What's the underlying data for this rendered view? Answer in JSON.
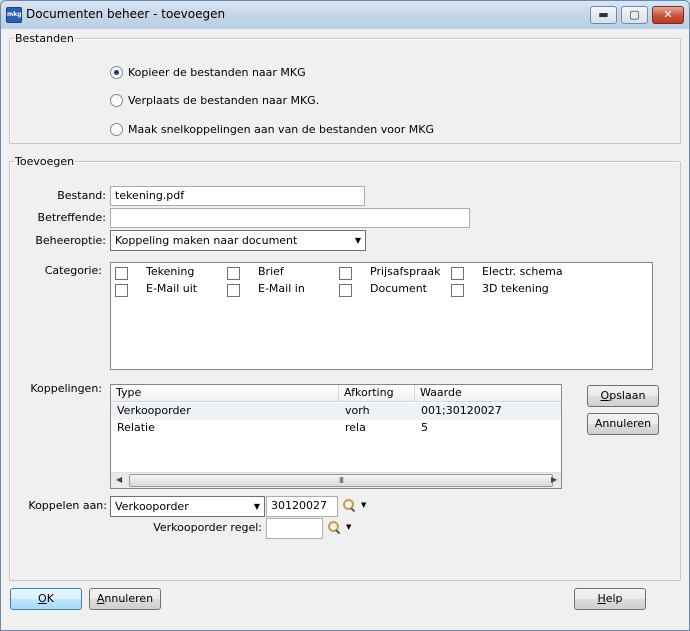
{
  "window": {
    "title": "Documenten beheer - toevoegen",
    "app_icon_text": "mkg",
    "minimize_glyph": "▬",
    "maximize_glyph": "▢",
    "close_glyph": "✕"
  },
  "bestanden": {
    "legend": "Bestanden",
    "options": [
      {
        "label": "Kopieer de bestanden naar MKG",
        "checked": true
      },
      {
        "label": "Verplaats de bestanden naar MKG.",
        "checked": false
      },
      {
        "label": "Maak snelkoppelingen aan van de bestanden voor MKG",
        "checked": false
      }
    ]
  },
  "toevoegen": {
    "legend": "Toevoegen",
    "bestand_label": "Bestand:",
    "bestand_value": "tekening.pdf",
    "betreffende_label": "Betreffende:",
    "betreffende_value": "",
    "beheeroptie_label": "Beheeroptie:",
    "beheeroptie_value": "Koppeling maken naar document",
    "categorie_label": "Categorie:",
    "categories": [
      [
        "Tekening",
        "Brief",
        "Prijsafspraak",
        "Electr. schema"
      ],
      [
        "E-Mail uit",
        "E-Mail in",
        "Document",
        "3D tekening"
      ]
    ],
    "koppelingen_label": "Koppelingen:",
    "koppelingen_columns": [
      "Type",
      "Afkorting",
      "Waarde"
    ],
    "koppelingen_rows": [
      [
        "Verkooporder",
        "vorh",
        "001;30120027"
      ],
      [
        "Relatie",
        "rela",
        "5"
      ]
    ],
    "scroll_left": "◀",
    "scroll_right": "▶",
    "scroll_grip": "III",
    "opslaan_label": "Opslaan",
    "opslaan_accel": "O",
    "opslaan_rest": "pslaan",
    "annuleren_label": "Annuleren",
    "koppelen_aan_label": "Koppelen aan:",
    "koppelen_aan_value": "Verkooporder",
    "koppelen_aan_number": "30120027",
    "verkooporder_regel_label": "Verkooporder regel:",
    "verkooporder_regel_value": ""
  },
  "footer": {
    "ok_accel": "O",
    "ok_rest": "K",
    "annuleren_accel": "A",
    "annuleren_rest": "nnuleren",
    "help_accel": "H",
    "help_rest": "elp"
  },
  "icons": {
    "dropdown_arrow": "▼",
    "small_dropdown_arrow": "▼"
  }
}
